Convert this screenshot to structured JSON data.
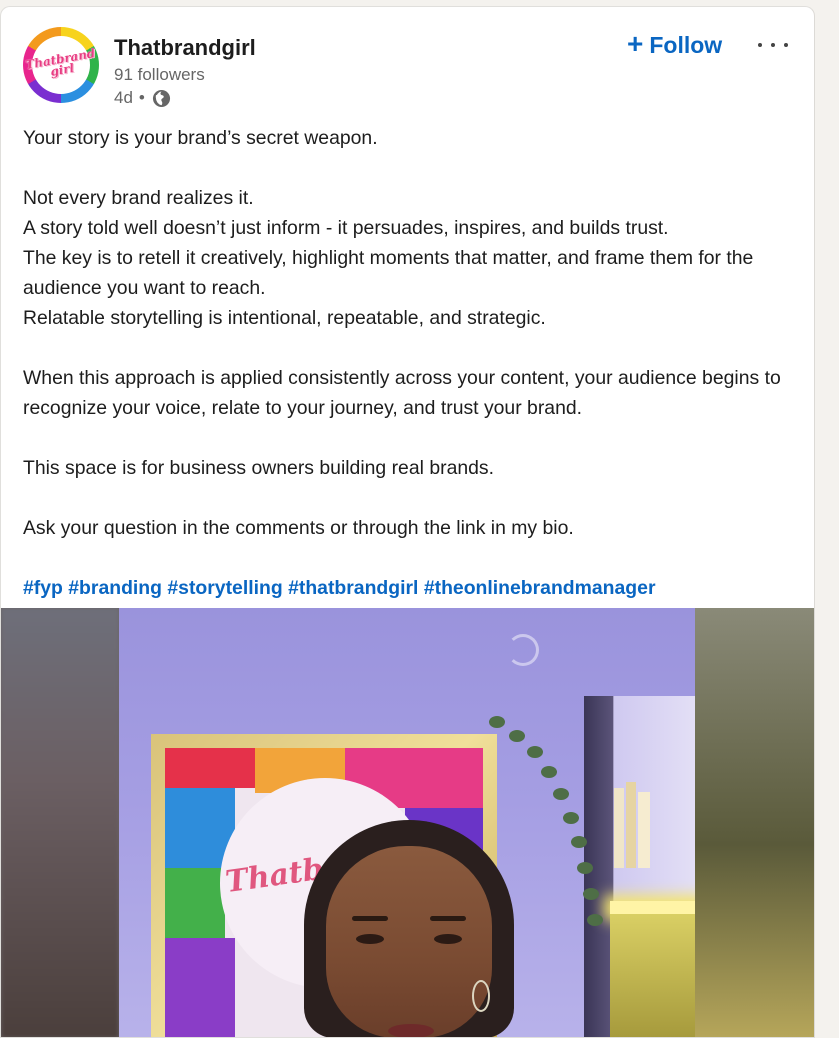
{
  "post": {
    "author": {
      "name": "Thatbrandgirl",
      "followers": "91 followers",
      "time": "4d",
      "separator": "•",
      "visibility_icon": "globe-icon",
      "avatar_text": "Thatbrand girl"
    },
    "follow_label": "Follow",
    "follow_icon": "plus-icon",
    "more_icon": "more-options-icon",
    "text": {
      "line1": "Your story is your brand’s secret weapon.",
      "line2": "Not every brand realizes it.",
      "line3": "A story told well doesn’t just inform - it persuades, inspires, and builds trust.",
      "line4": "The key is to retell it creatively, highlight moments that matter, and frame them for the audience you want to reach.",
      "line5": "Relatable storytelling is intentional, repeatable, and strategic.",
      "line6": "When this approach is applied consistently across your content, your audience begins to recognize your voice, relate to your journey, and trust your brand.",
      "line7": "This space is for business owners building real brands.",
      "line8": "Ask your question in the comments or through the link in my bio."
    },
    "hashtags": [
      "#fyp",
      "#branding",
      "#storytelling",
      "#thatbrandgirl",
      "#theonlinebrandmanager"
    ],
    "media": {
      "type": "video",
      "art_text": "Thatbrand"
    }
  },
  "colors": {
    "link": "#0a66c2",
    "text": "#1d1d1d",
    "muted": "#666666",
    "background": "#f4f2ee"
  }
}
